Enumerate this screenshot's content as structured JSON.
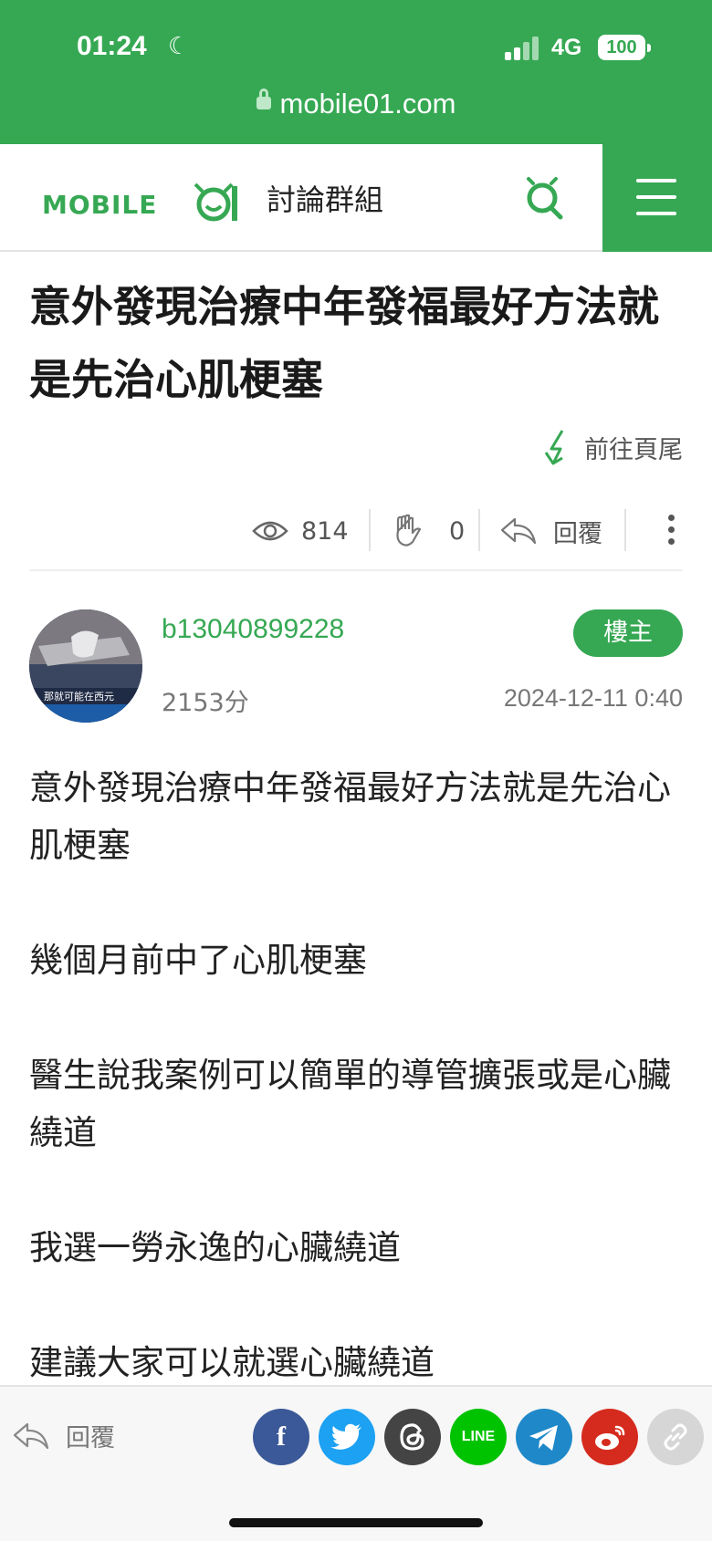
{
  "status_bar": {
    "time": "01:24",
    "network": "4G",
    "battery": "100"
  },
  "browser": {
    "url": "mobile01.com"
  },
  "header": {
    "logo": "MOBILE01",
    "section": "討論群組"
  },
  "post": {
    "title": "意外發現治療中年發福最好方法就是先治心肌梗塞",
    "goto_bottom": "前往頁尾",
    "views": "814",
    "likes": "0",
    "reply_label": "回覆",
    "author": {
      "username": "b13040899228",
      "score": "2153分",
      "badge": "樓主",
      "date": "2024-12-11 0:40",
      "avatar_caption": "那就可能在西元"
    },
    "paragraphs": [
      "意外發現治療中年發福最好方法就是先治心肌梗塞",
      "幾個月前中了心肌梗塞",
      "醫生說我案例可以簡單的導管擴張或是心臟繞道",
      "我選一勞永逸的心臟繞道",
      "建議大家可以就選心臟繞道"
    ]
  },
  "bottom_bar": {
    "reply_label": "回覆",
    "share": [
      "facebook",
      "twitter",
      "threads",
      "LINE",
      "telegram",
      "weibo",
      "link"
    ]
  },
  "colors": {
    "brand": "#36a853",
    "facebook": "#3b5998",
    "twitter": "#1da1f2",
    "threads": "#444444",
    "line": "#00c300",
    "telegram": "#1f88c9",
    "weibo": "#d52b1e",
    "link": "#d6d6d6"
  }
}
